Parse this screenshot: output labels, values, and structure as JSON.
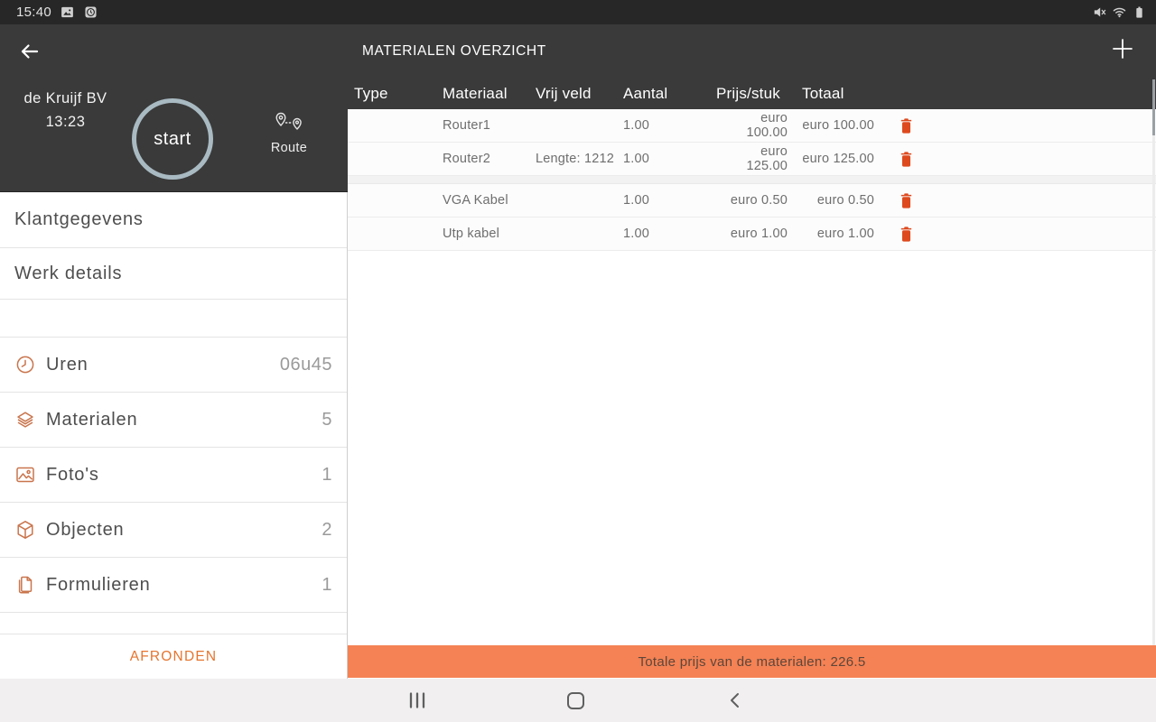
{
  "status_bar": {
    "time": "15:40",
    "notification_icons": [
      "image-icon",
      "clock-icon"
    ],
    "system_icons": [
      "mute-icon",
      "wifi-icon",
      "battery-icon"
    ]
  },
  "header": {
    "title": "MATERIALEN OVERZICHT"
  },
  "sidebar": {
    "company": "de Kruijf BV",
    "time": "13:23",
    "start_button": "start",
    "route_label": "Route",
    "nav_items": [
      {
        "label": "Klantgegevens"
      },
      {
        "label": "Werk details"
      }
    ],
    "counters": [
      {
        "icon": "clock",
        "label": "Uren",
        "value": "06u45"
      },
      {
        "icon": "layers",
        "label": "Materialen",
        "value": "5"
      },
      {
        "icon": "photo",
        "label": "Foto's",
        "value": "1"
      },
      {
        "icon": "cube",
        "label": "Objecten",
        "value": "2"
      },
      {
        "icon": "document",
        "label": "Formulieren",
        "value": "1"
      }
    ],
    "finish_button": "AFRONDEN"
  },
  "table": {
    "columns": [
      "Type",
      "Materiaal",
      "Vrij veld",
      "Aantal",
      "Prijs/stuk",
      "Totaal"
    ],
    "rows": [
      {
        "type": "",
        "materiaal": "Router1",
        "vrij_veld": "",
        "aantal": "1.00",
        "prijs_stuk": "euro 100.00",
        "totaal": "euro 100.00"
      },
      {
        "type": "",
        "materiaal": "Router2",
        "vrij_veld": "Lengte: 1212",
        "aantal": "1.00",
        "prijs_stuk": "euro 125.00",
        "totaal": "euro 125.00"
      },
      {
        "type": "",
        "materiaal": "VGA Kabel",
        "vrij_veld": "",
        "aantal": "1.00",
        "prijs_stuk": "euro 0.50",
        "totaal": "euro 0.50"
      },
      {
        "type": "",
        "materiaal": "Utp kabel",
        "vrij_veld": "",
        "aantal": "1.00",
        "prijs_stuk": "euro 1.00",
        "totaal": "euro 1.00"
      }
    ]
  },
  "footer": {
    "total_text": "Totale prijs van de materialen: 226.5"
  },
  "colors": {
    "dark_header": "#3a3a3a",
    "icon_orange": "#c9754d",
    "trash_orange": "#dd4a1e",
    "accent_orange": "#e5752e",
    "footer_orange": "#f48254",
    "start_circle": "#a9bac2"
  }
}
